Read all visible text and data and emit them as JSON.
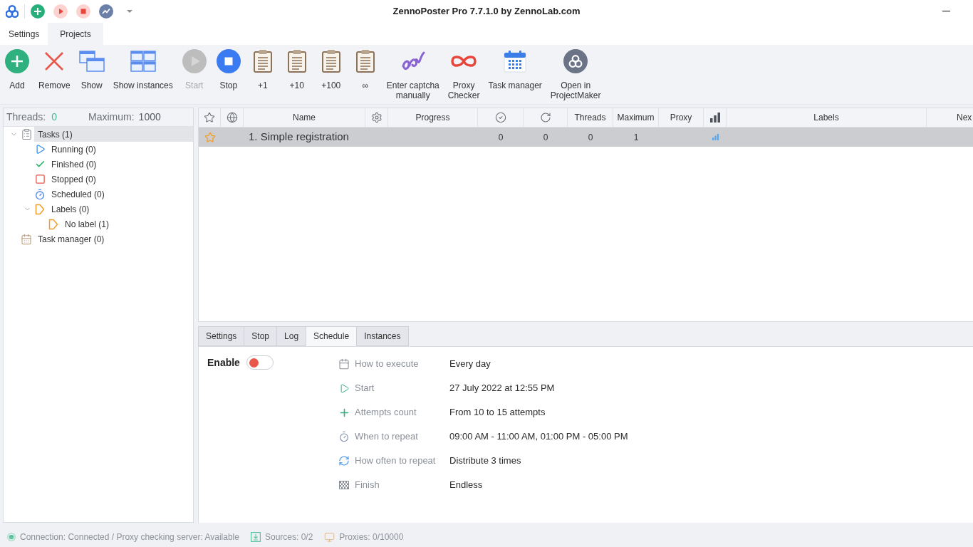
{
  "window": {
    "title": "ZennoPoster Pro 7.7.1.0 by ZennoLab.com"
  },
  "ribbon_tabs": [
    {
      "label": "Settings",
      "selected": false
    },
    {
      "label": "Projects",
      "selected": true
    }
  ],
  "toolbar": [
    {
      "label": "Add",
      "disabled": false
    },
    {
      "label": "Remove",
      "disabled": false
    },
    {
      "label": "Show",
      "disabled": false
    },
    {
      "label": "Show instances",
      "disabled": false
    },
    {
      "label": "Start",
      "disabled": true
    },
    {
      "label": "Stop",
      "disabled": false
    },
    {
      "label": "+1",
      "disabled": false
    },
    {
      "label": "+10",
      "disabled": false
    },
    {
      "label": "+100",
      "disabled": false
    },
    {
      "label": "∞",
      "disabled": false
    },
    {
      "label": "Enter captcha\nmanually",
      "disabled": false
    },
    {
      "label": "Proxy\nChecker",
      "disabled": false
    },
    {
      "label": "Task manager",
      "disabled": false
    },
    {
      "label": "Open in\nProjectMaker",
      "disabled": false
    }
  ],
  "threads_panel": {
    "threads_label": "Threads:",
    "threads_value": "0",
    "maximum_label": "Maximum:",
    "maximum_value": "1000",
    "tree": [
      {
        "kind": "tasks",
        "label": "Tasks (1)",
        "selected": true,
        "expanded": true,
        "children": [
          {
            "kind": "running",
            "label": "Running (0)",
            "selected": false
          },
          {
            "kind": "finished",
            "label": "Finished (0)",
            "selected": false
          },
          {
            "kind": "stopped",
            "label": "Stopped (0)",
            "selected": false
          },
          {
            "kind": "scheduled",
            "label": "Scheduled (0)",
            "selected": false
          },
          {
            "kind": "labels",
            "label": "Labels (0)",
            "selected": false,
            "expanded": true,
            "children": [
              {
                "kind": "label",
                "label": "No label (1)",
                "selected": false
              }
            ]
          }
        ]
      },
      {
        "kind": "manager",
        "label": "Task manager (0)",
        "selected": false
      }
    ]
  },
  "projects_table": {
    "columns": [
      {
        "kind": "icon"
      },
      {
        "kind": "icon"
      },
      {
        "kind": "text",
        "label": "Name"
      },
      {
        "kind": "icon"
      },
      {
        "kind": "text",
        "label": "Progress"
      },
      {
        "kind": "icon"
      },
      {
        "kind": "icon"
      },
      {
        "kind": "text",
        "label": "Threads"
      },
      {
        "kind": "text",
        "label": "Maximum"
      },
      {
        "kind": "text",
        "label": "Proxy"
      },
      {
        "kind": "icon"
      },
      {
        "kind": "text",
        "label": "Labels"
      },
      {
        "kind": "text",
        "label": "Nex"
      }
    ],
    "rows": [
      {
        "selected": true,
        "name": "1. Simple registration",
        "column_6": "0",
        "column_7": "0",
        "threads": "0",
        "maximum": "1"
      }
    ]
  },
  "detail_tabs": [
    {
      "label": "Settings",
      "selected": false
    },
    {
      "label": "Stop",
      "selected": false
    },
    {
      "label": "Log",
      "selected": false
    },
    {
      "label": "Schedule",
      "selected": true
    },
    {
      "label": "Instances",
      "selected": false
    }
  ],
  "schedule": {
    "enable": {
      "label": "Enable",
      "on": false
    },
    "fields": [
      {
        "label": "How to execute",
        "value": "Every day"
      },
      {
        "label": "Start",
        "value": "27 July 2022 at 12:55 PM"
      },
      {
        "label": "Attempts count",
        "value": "From 10 to 15 attempts"
      },
      {
        "label": "When to repeat",
        "value": "09:00 AM - 11:00 AM, 01:00 PM - 05:00 PM"
      },
      {
        "label": "How often to repeat",
        "value": "Distribute 3 times"
      },
      {
        "label": "Finish",
        "value": "Endless"
      }
    ]
  },
  "status_bar": [
    {
      "text": "Connection: Connected / Proxy checking server: Available"
    },
    {
      "text": "Sources: 0/2"
    },
    {
      "text": "Proxies: 0/10000"
    }
  ]
}
